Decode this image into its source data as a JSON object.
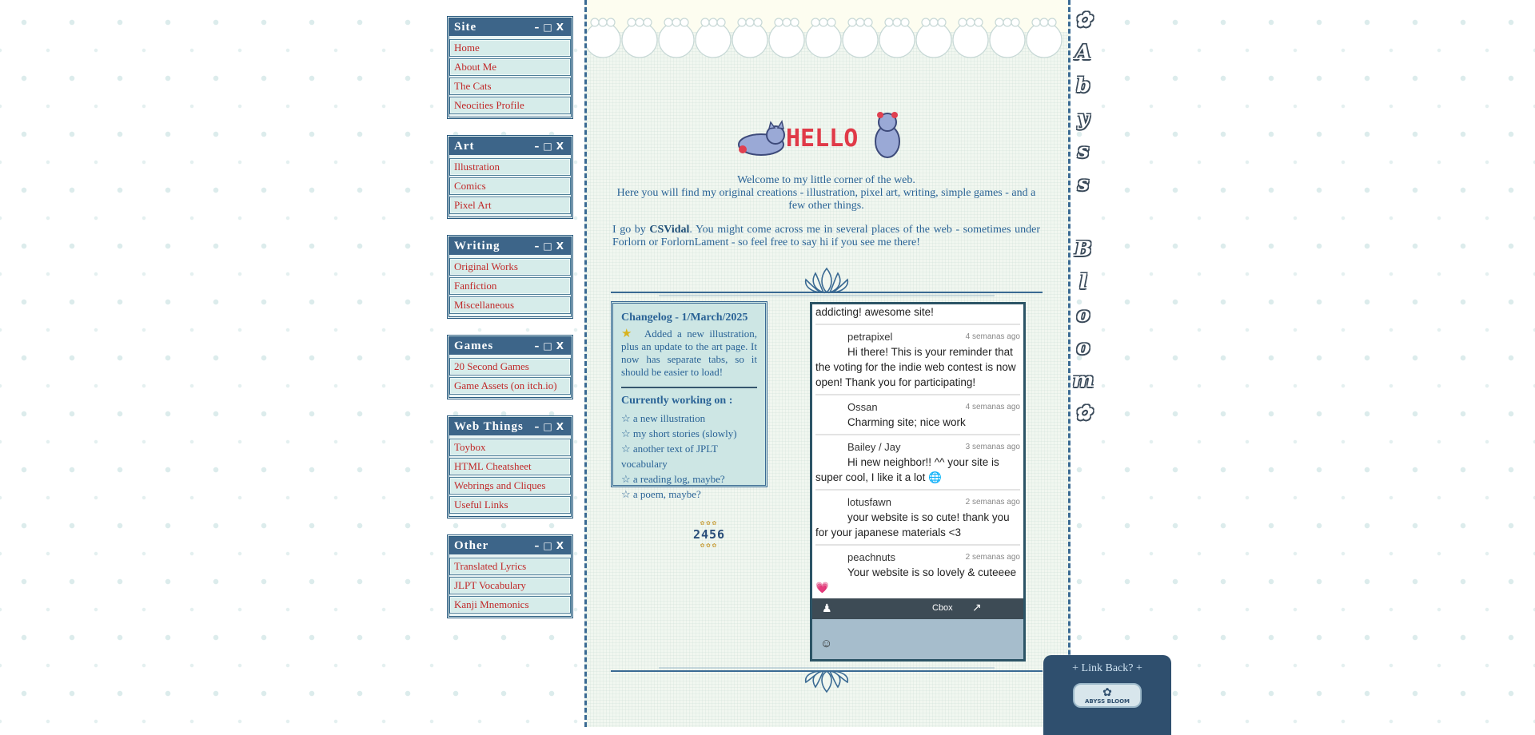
{
  "menu": [
    {
      "title": "Site",
      "links": [
        "Home",
        "About Me",
        "The Cats",
        "Neocities Profile"
      ]
    },
    {
      "title": "Art",
      "links": [
        "Illustration",
        "Comics",
        "Pixel Art"
      ]
    },
    {
      "title": "Writing",
      "links": [
        "Original Works",
        "Fanfiction",
        "Miscellaneous"
      ]
    },
    {
      "title": "Games",
      "links": [
        "20 Second Games",
        "Game Assets (on itch.io)"
      ]
    },
    {
      "title": "Web Things",
      "links": [
        "Toybox",
        "HTML Cheatsheet",
        "Webrings and Cliques",
        "Useful Links"
      ]
    },
    {
      "title": "Other",
      "links": [
        "Translated Lyrics",
        "JLPT Vocabulary",
        "Kanji Mnemonics"
      ]
    }
  ],
  "window_controls": {
    "minimize": "–",
    "maximize": "□",
    "close": "X"
  },
  "hello_text": "HELLO",
  "intro": {
    "line1": "Welcome to my little corner of the web.",
    "line2": "Here you will find my original creations - illustration, pixel art, writing, simple games - and a few other things.",
    "p2_before": "I go by ",
    "p2_name": "CSVidal",
    "p2_after": ". You might come across me in several places of the web - sometimes under Forlorn or ForlornLament - so feel free to say hi if you see me there!"
  },
  "changelog": {
    "title": "Changelog - 1/March/2025",
    "entry": "Added a new illustration, plus an update to the art page. It now has separate tabs, so it should be easier to load!",
    "working_title": "Currently working on :",
    "working_items": [
      "☆ a new illustration",
      "☆ my short stories (slowly)",
      "☆ another text of JPLT vocabulary",
      "☆ a reading log, maybe?",
      "☆ a poem, maybe?"
    ]
  },
  "hit_counter": "2456",
  "cbox": {
    "top_fragment": "addicting! awesome site!",
    "messages": [
      {
        "name": "petrapixel",
        "time": "4 semanas ago",
        "text": "Hi there! This is your reminder that the voting for the indie web contest is now open! Thank you for participating!"
      },
      {
        "name": "Ossan",
        "time": "4 semanas ago",
        "text": "Charming site; nice work"
      },
      {
        "name": "Bailey / Jay",
        "time": "3 semanas ago",
        "text": "Hi new neighbor!! ^^ your site is super cool, I like it a lot 🌐"
      },
      {
        "name": "lotusfawn",
        "time": "2 semanas ago",
        "text": "your website is so cute! thank you for your japanese materials <3"
      },
      {
        "name": "peachnuts",
        "time": "2 semanas ago",
        "text": "Your website is so lovely & cuteeee 💗"
      }
    ],
    "bar_label": "Cbox"
  },
  "vertical_title": [
    "✿",
    "A",
    "b",
    "y",
    "s",
    "s",
    "",
    "B",
    "l",
    "o",
    "o",
    "m",
    "✿"
  ],
  "linkback": {
    "title": "+ Link Back? +",
    "button_text": "ABYSS BLOOM"
  },
  "colors": {
    "accent_blue": "#3d6589",
    "link_red": "#c02828",
    "text_blue": "#2a6396",
    "panel_teal": "#cde6e4"
  }
}
